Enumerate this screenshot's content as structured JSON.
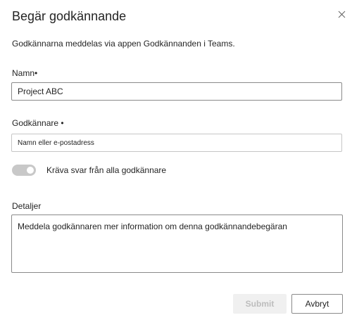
{
  "dialog": {
    "title": "Begär godkännande",
    "subtitle": "Godkännarna meddelas via appen Godkännanden i Teams.",
    "close_icon": "close-icon"
  },
  "form": {
    "name": {
      "label": "Namn•",
      "value": "Project ABC"
    },
    "approvers": {
      "label": "Godkännare •",
      "placeholder": "Namn eller e-postadress"
    },
    "require_all": {
      "label": "Kräva svar från alla godkännare",
      "state": "off"
    },
    "details": {
      "label": "Detaljer",
      "placeholder": "Meddela godkännaren mer information om denna godkännandebegäran"
    }
  },
  "actions": {
    "submit_label": "Submit",
    "cancel_label": "Avbryt"
  }
}
